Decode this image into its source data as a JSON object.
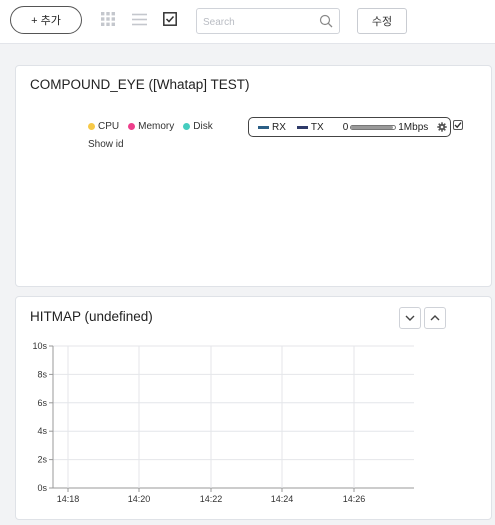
{
  "toolbar": {
    "add_label": "+ 추가",
    "edit_label": "수정",
    "search_placeholder": "Search",
    "view_icons": [
      "grid-view-icon",
      "list-view-icon",
      "checkbox-view-icon"
    ]
  },
  "compound_eye": {
    "title": "COMPOUND_EYE ([Whatap] TEST)",
    "legend": [
      {
        "label": "CPU",
        "color": "#f7c948"
      },
      {
        "label": "Memory",
        "color": "#ee3f8c"
      },
      {
        "label": "Disk",
        "color": "#45cdbf"
      }
    ],
    "show_id": "Show id",
    "network": {
      "rx_label": "RX",
      "rx_color": "#2b5f86",
      "tx_label": "TX",
      "tx_color": "#2e3a69",
      "min_label": "0",
      "max_label": "1Mbps",
      "slider_level": 0.95,
      "enabled": true
    }
  },
  "hitmap": {
    "title": "HITMAP (undefined)"
  },
  "chart_data": {
    "type": "heatmap",
    "title": "HITMAP (undefined)",
    "xlabel": "",
    "ylabel": "",
    "x_ticks": [
      "14:18",
      "14:20",
      "14:22",
      "14:24",
      "14:26"
    ],
    "y_ticks": [
      "0s",
      "2s",
      "4s",
      "6s",
      "8s",
      "10s"
    ],
    "ylim": [
      0,
      10
    ],
    "grid": true,
    "points": []
  }
}
